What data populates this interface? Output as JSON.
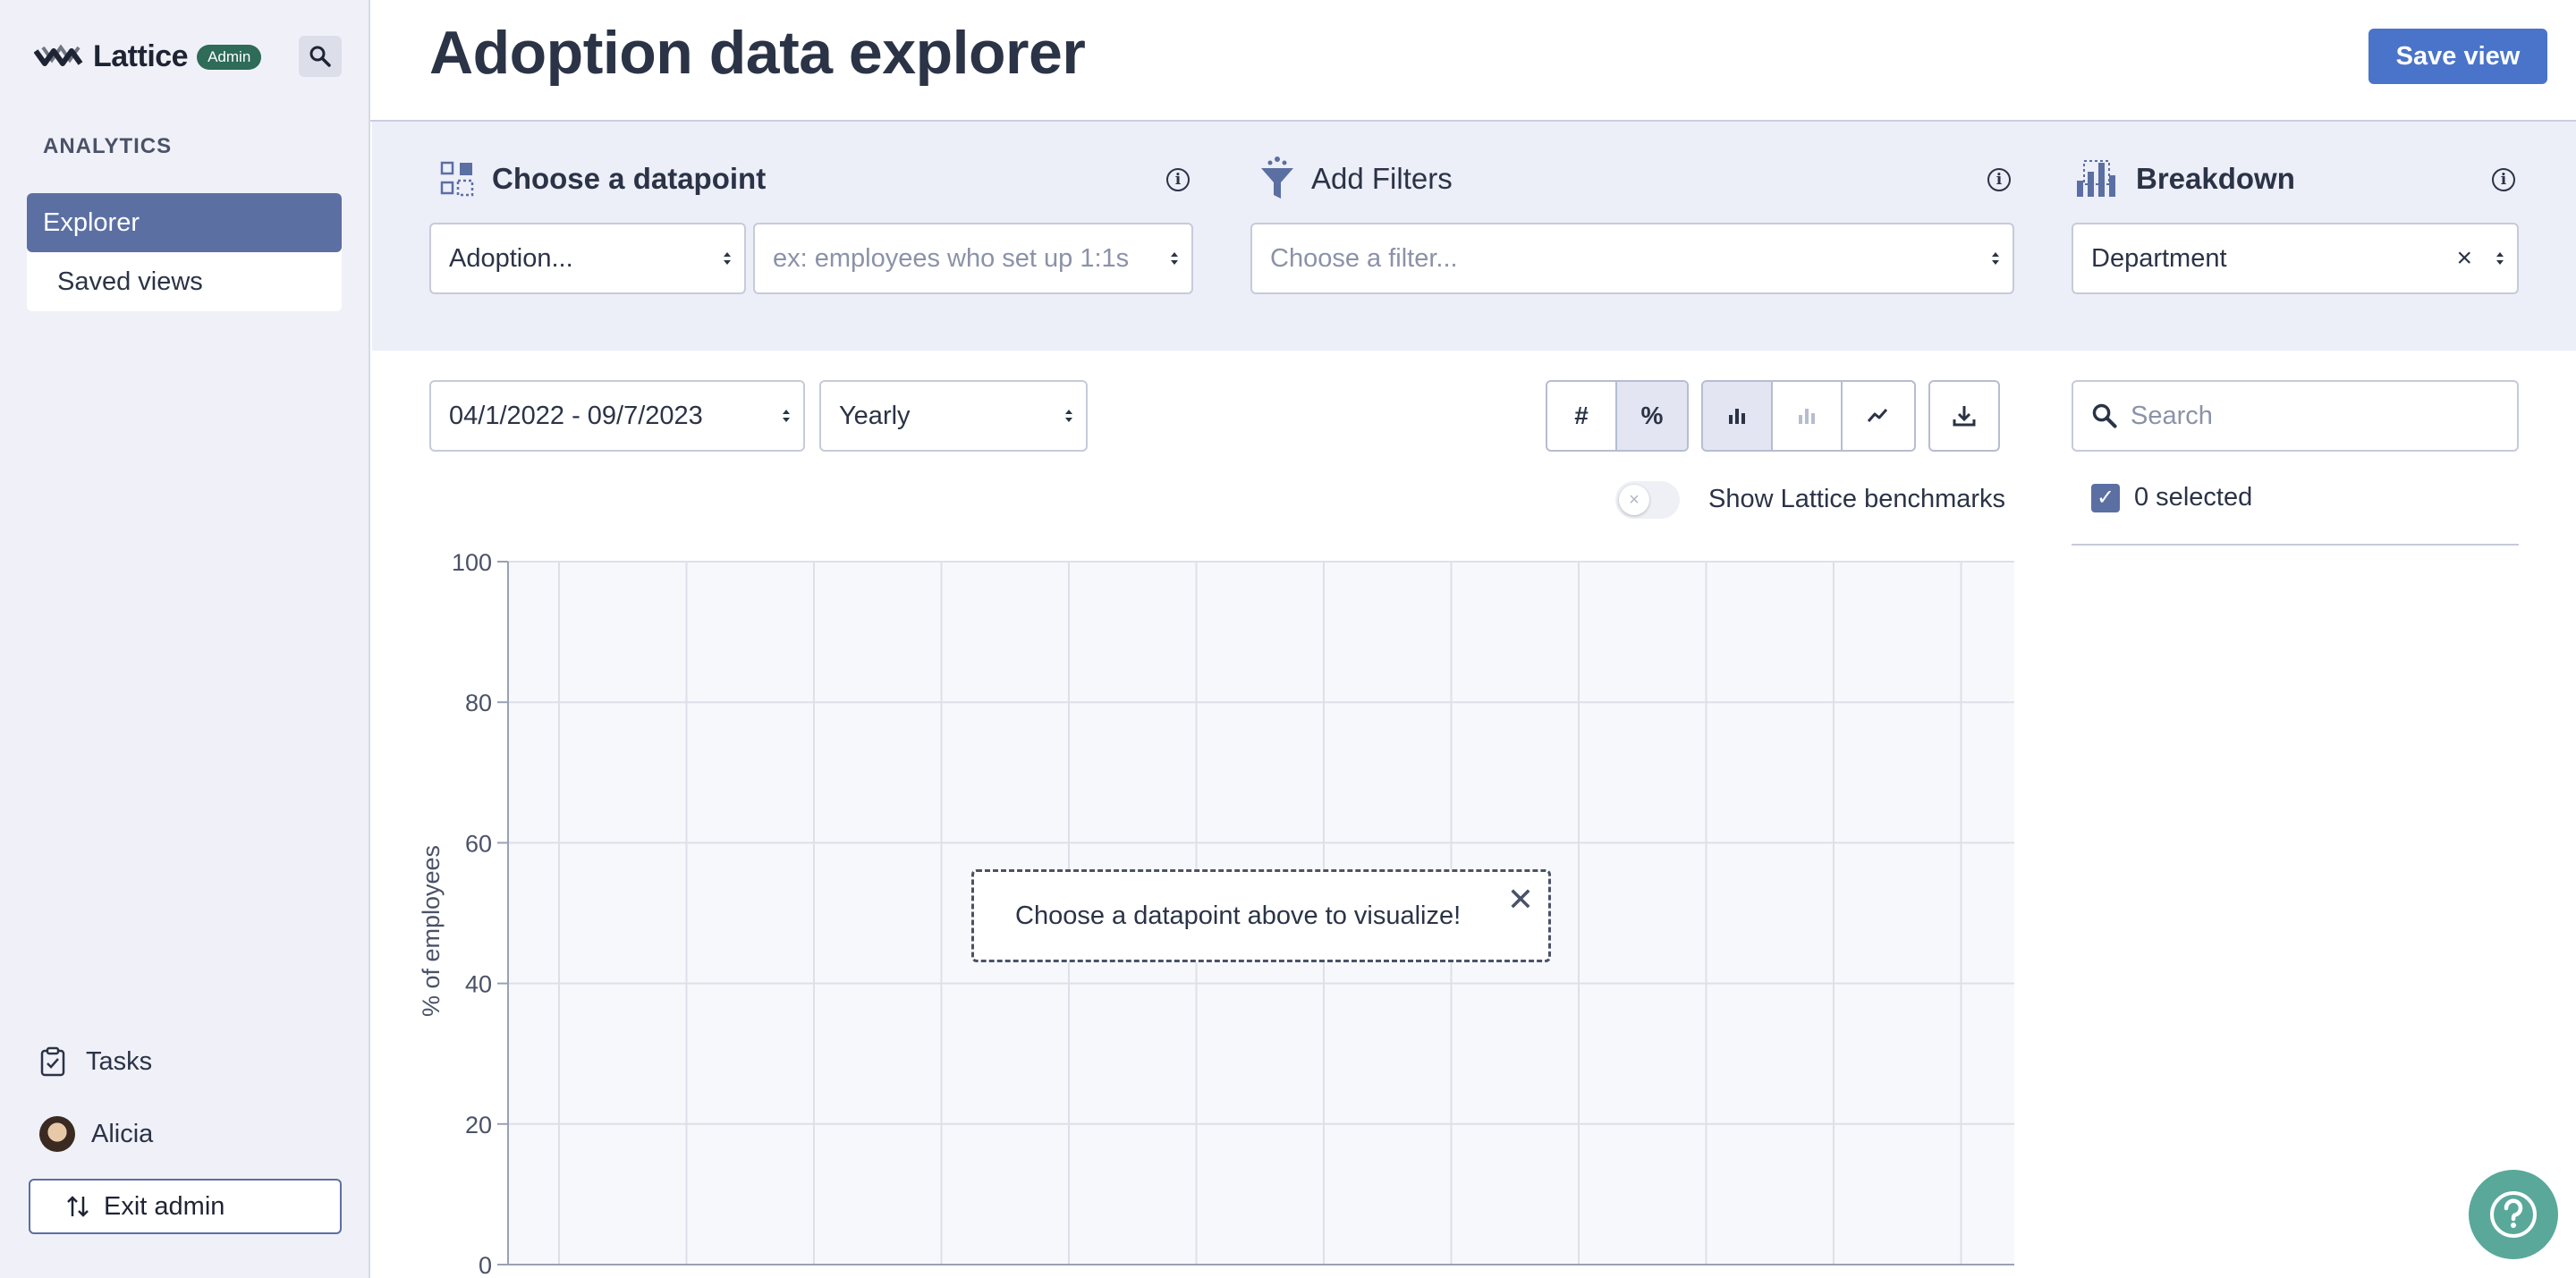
{
  "app": {
    "name": "Lattice",
    "badge": "Admin"
  },
  "sidebar": {
    "section": "ANALYTICS",
    "items": [
      {
        "label": "Explorer",
        "active": true
      },
      {
        "label": "Saved views",
        "active": false
      }
    ],
    "tasks_label": "Tasks",
    "user_name": "Alicia",
    "exit_label": "Exit admin"
  },
  "header": {
    "title": "Adoption data explorer",
    "save_label": "Save view"
  },
  "controls": {
    "datapoint": {
      "title": "Choose a datapoint",
      "select_value": "Adoption...",
      "sub_placeholder": "ex: employees who set up 1:1s"
    },
    "filters": {
      "title": "Add Filters",
      "placeholder": "Choose a filter..."
    },
    "breakdown": {
      "title": "Breakdown",
      "value": "Department"
    }
  },
  "toolbar": {
    "date_range": "04/1/2022 - 09/7/2023",
    "interval": "Yearly",
    "count_label": "#",
    "percent_label": "%",
    "benchmarks_label": "Show Lattice benchmarks"
  },
  "right_panel": {
    "search_placeholder": "Search",
    "selected_text": "0 selected"
  },
  "empty_state": {
    "message": "Choose a datapoint above to visualize!"
  },
  "colors": {
    "accent": "#4a74c9",
    "nav_active": "#5b6fa3",
    "help": "#5aa89a",
    "brand_badge": "#2e6b58"
  },
  "chart_data": {
    "type": "bar",
    "ylabel": "% of employees",
    "ylim": [
      0,
      100
    ],
    "yticks": [
      "100",
      "80",
      "60",
      "40",
      "20",
      "0"
    ],
    "grid": true,
    "series": []
  }
}
